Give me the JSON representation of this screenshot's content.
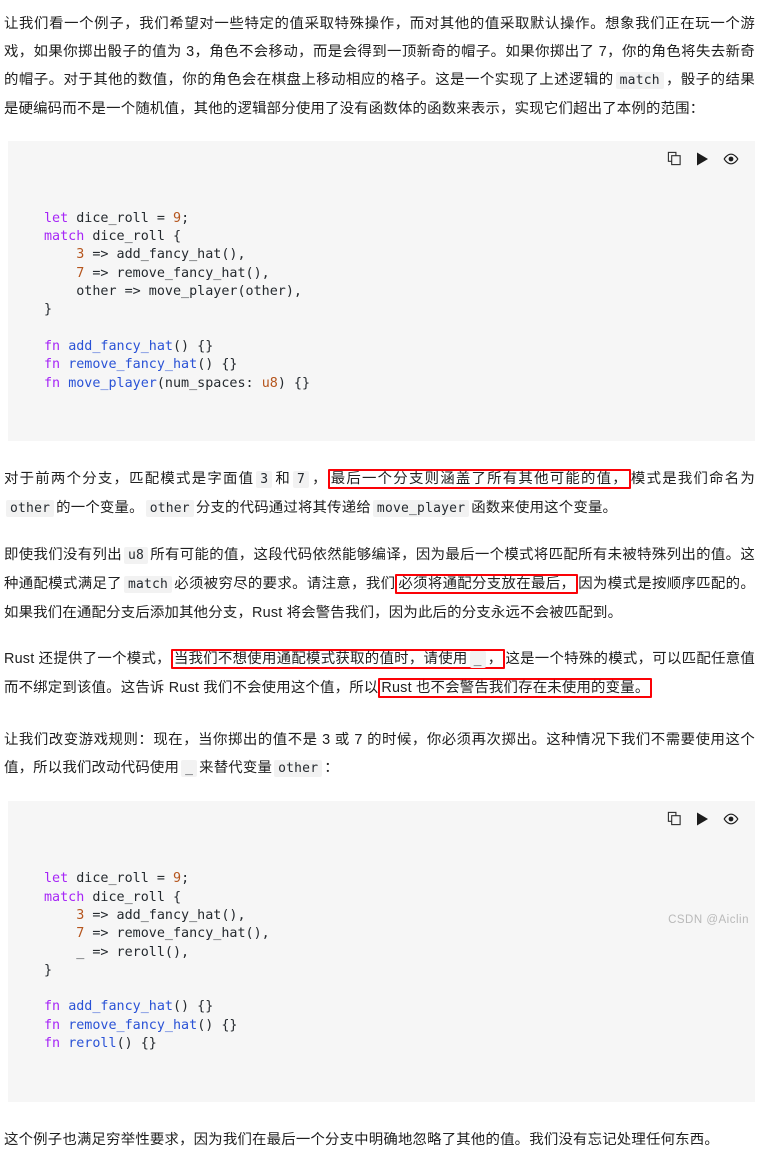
{
  "colors": {
    "annotation_red": "#fb0207",
    "code_bg": "#f6f6f6",
    "inline_code_bg": "#f2f2f2",
    "keyword": "#a626f7",
    "number": "#b5551d",
    "function": "#2a52d6",
    "text": "#202020",
    "watermark": "#b9b9b9"
  },
  "paragraphs": {
    "p1_a": "让我们看一个例子，我们希望对一些特定的值采取特殊操作，而对其他的值采取默认操作。想象我们正在玩一个游戏，如果你掷出骰子的值为 3，角色不会移动，而是会得到一顶新奇的帽子。如果你掷出了 7，你的角色将失去新奇的帽子。对于其他的数值，你的角色会在棋盘上移动相应的格子。这是一个实现了上述逻辑的",
    "p1_code": "match",
    "p1_b": "，骰子的结果是硬编码而不是一个随机值，其他的逻辑部分使用了没有函数体的函数来表示，实现它们超出了本例的范围：",
    "p2_a": "对于前两个分支，匹配模式是字面值",
    "p2_code1": "3",
    "p2_mid1": "和",
    "p2_code2": "7",
    "p2_mid2": "，",
    "p2_highlight": "最后一个分支则涵盖了所有其他可能的值，",
    "p2_b": "模式是我们命名为",
    "p2_code3": "other",
    "p2_c": "的一个变量。",
    "p2_code4": "other",
    "p2_d": "分支的代码通过将其传递给",
    "p2_code5": "move_player",
    "p2_e": "函数来使用这个变量。",
    "p3_a": "即使我们没有列出",
    "p3_code1": "u8",
    "p3_b": "所有可能的值，这段代码依然能够编译，因为最后一个模式将匹配所有未被特殊列出的值。这种通配模式满足了",
    "p3_code2": "match",
    "p3_c": "必须被穷尽的要求。请注意，我们",
    "p3_highlight": "必须将通配分支放在最后，",
    "p3_d": "因为模式是按顺序匹配的。如果我们在通配分支后添加其他分支，Rust 将会警告我们，因为此后的分支永远不会被匹配到。",
    "p4_a": "Rust 还提供了一个模式，",
    "p4_highlight1_pre": "当我们不想使用通配模式获取的值时，请使用",
    "p4_highlight1_code": "_",
    "p4_highlight1_post": "，",
    "p4_b": "这是一个特殊的模式，可以匹配任意值而不绑定到该值。这告诉 Rust 我们不会使用这个值，所以",
    "p4_highlight2": "Rust 也不会警告我们存在未使用的变量。",
    "p5_a": "让我们改变游戏规则：现在，当你掷出的值不是 3 或 7 的时候，你必须再次掷出。这种情况下我们不需要使用这个值，所以我们改动代码使用",
    "p5_code1": "_",
    "p5_b": "来替代变量",
    "p5_code2": "other",
    "p5_c": "：",
    "p6": "这个例子也满足穷举性要求，因为我们在最后一个分支中明确地忽略了其他的值。我们没有忘记处理任何东西。"
  },
  "code_toolbar": {
    "copy_icon": "copy-icon",
    "run_icon": "play-icon",
    "preview_icon": "eye-icon"
  },
  "code_block_1": {
    "lines": [
      [
        {
          "t": "let ",
          "c": "k"
        },
        {
          "t": "dice_roll = ",
          "c": "pl"
        },
        {
          "t": "9",
          "c": "n"
        },
        {
          "t": ";",
          "c": "pl"
        }
      ],
      [
        {
          "t": "match ",
          "c": "k"
        },
        {
          "t": "dice_roll {",
          "c": "pl"
        }
      ],
      [
        {
          "t": "    ",
          "c": "pl"
        },
        {
          "t": "3",
          "c": "n"
        },
        {
          "t": " => add_fancy_hat(),",
          "c": "pl"
        }
      ],
      [
        {
          "t": "    ",
          "c": "pl"
        },
        {
          "t": "7",
          "c": "n"
        },
        {
          "t": " => remove_fancy_hat(),",
          "c": "pl"
        }
      ],
      [
        {
          "t": "    other => move_player(other),",
          "c": "pl"
        }
      ],
      [
        {
          "t": "}",
          "c": "pl"
        }
      ],
      [
        {
          "t": " ",
          "c": "pl"
        }
      ],
      [
        {
          "t": "fn ",
          "c": "k"
        },
        {
          "t": "add_fancy_hat",
          "c": "fnname"
        },
        {
          "t": "() {}",
          "c": "pl"
        }
      ],
      [
        {
          "t": "fn ",
          "c": "k"
        },
        {
          "t": "remove_fancy_hat",
          "c": "fnname"
        },
        {
          "t": "() {}",
          "c": "pl"
        }
      ],
      [
        {
          "t": "fn ",
          "c": "k"
        },
        {
          "t": "move_player",
          "c": "fnname"
        },
        {
          "t": "(num_spaces: ",
          "c": "pl"
        },
        {
          "t": "u8",
          "c": "n"
        },
        {
          "t": ") {}",
          "c": "pl"
        }
      ]
    ]
  },
  "code_block_2": {
    "lines": [
      [
        {
          "t": "let ",
          "c": "k"
        },
        {
          "t": "dice_roll = ",
          "c": "pl"
        },
        {
          "t": "9",
          "c": "n"
        },
        {
          "t": ";",
          "c": "pl"
        }
      ],
      [
        {
          "t": "match ",
          "c": "k"
        },
        {
          "t": "dice_roll {",
          "c": "pl"
        }
      ],
      [
        {
          "t": "    ",
          "c": "pl"
        },
        {
          "t": "3",
          "c": "n"
        },
        {
          "t": " => add_fancy_hat(),",
          "c": "pl"
        }
      ],
      [
        {
          "t": "    ",
          "c": "pl"
        },
        {
          "t": "7",
          "c": "n"
        },
        {
          "t": " => remove_fancy_hat(),",
          "c": "pl"
        }
      ],
      [
        {
          "t": "    _ => reroll(),",
          "c": "pl"
        }
      ],
      [
        {
          "t": "}",
          "c": "pl"
        }
      ],
      [
        {
          "t": " ",
          "c": "pl"
        }
      ],
      [
        {
          "t": "fn ",
          "c": "k"
        },
        {
          "t": "add_fancy_hat",
          "c": "fnname"
        },
        {
          "t": "() {}",
          "c": "pl"
        }
      ],
      [
        {
          "t": "fn ",
          "c": "k"
        },
        {
          "t": "remove_fancy_hat",
          "c": "fnname"
        },
        {
          "t": "() {}",
          "c": "pl"
        }
      ],
      [
        {
          "t": "fn ",
          "c": "k"
        },
        {
          "t": "reroll",
          "c": "fnname"
        },
        {
          "t": "() {}",
          "c": "pl"
        }
      ]
    ]
  },
  "watermark": "CSDN @Aiclin"
}
